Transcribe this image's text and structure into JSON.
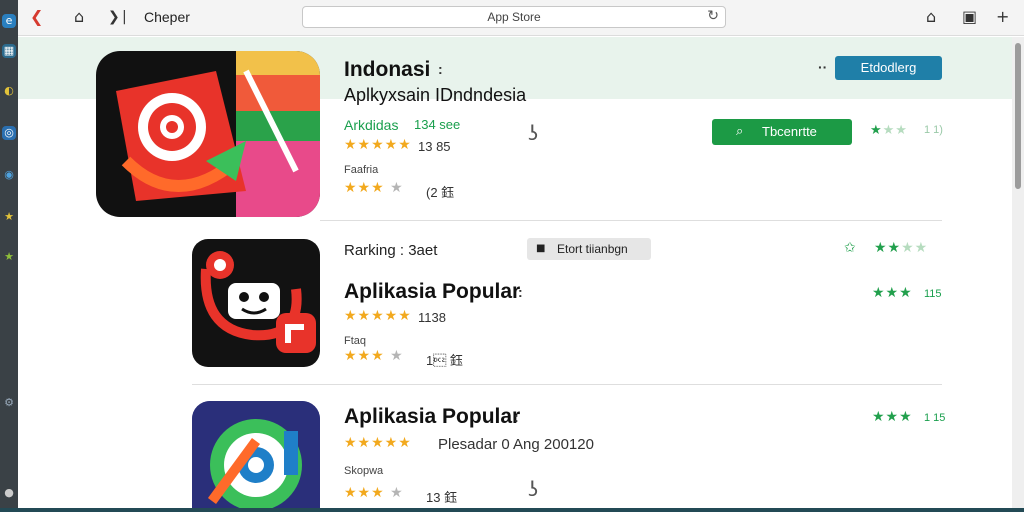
{
  "toolbar": {
    "back_icon": "back-icon",
    "window_title": "Cheper",
    "address": "App Store",
    "reload_icon": "reload-icon"
  },
  "featured": {
    "title": "Indonasi",
    "subtitle": "Aplkyxsain IDndndesia",
    "green_label": "Arkdidas",
    "green_count": "134 see",
    "rating_count": "13 85",
    "label": "Faafria",
    "rating2_count": "(2 鈺",
    "install_button": "Etdodlerg",
    "search_button": "Tbcenrtte",
    "side_rating": "1 1)"
  },
  "ranking": {
    "title": "Rarking : 3aet",
    "chip_label": "Etort tiianbgn"
  },
  "apps": [
    {
      "title": "Aplikasia Popular",
      "rating_count": "1138",
      "label": "Ftaq",
      "rating2_count": "1\u0012 鈺",
      "side_rating": "115"
    },
    {
      "title": "Aplikasia Popular",
      "desc": "Plesadar 0 Ang 200120",
      "label": "Skopwa",
      "rating2_count": "13 鈺",
      "side_rating": "1 15"
    }
  ],
  "colors": {
    "accent_blue": "#1f7fa8",
    "accent_green": "#1c9a45",
    "star_gold": "#f2a91e"
  }
}
